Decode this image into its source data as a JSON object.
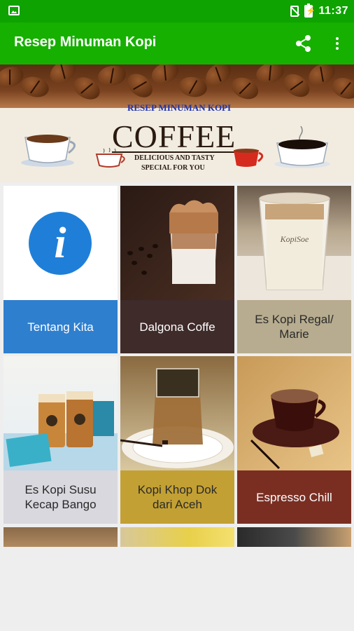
{
  "status_bar": {
    "time": "11:37",
    "icons": [
      "image-notification-icon",
      "no-sim-icon",
      "battery-charging-icon"
    ]
  },
  "app_bar": {
    "title": "Resep Minuman Kopi",
    "actions": [
      "share-icon",
      "more-vert-icon"
    ],
    "color": "#16b000"
  },
  "banner": {
    "label": "RESEP MINUMAN KOPI",
    "title": "COFFEE",
    "subtitle_line1": "DELICIOUS AND TASTY",
    "subtitle_line2": "SPECIAL FOR YOU"
  },
  "menu": {
    "items": [
      {
        "label": "Tentang Kita",
        "icon": "info-icon",
        "label_bg": "#2f7fcf"
      },
      {
        "label": "Dalgona Coffe",
        "icon": "dalgona-coffee-photo",
        "label_bg": "#3e2b2a"
      },
      {
        "label": "Es Kopi Regal/ Marie",
        "icon": "iced-coffee-cup-photo",
        "label_bg": "#b7ac8f"
      },
      {
        "label": "Es Kopi Susu Kecap Bango",
        "icon": "iced-coffee-bottles-photo",
        "label_bg": "#d8d8de"
      },
      {
        "label": "Kopi Khop Dok dari Aceh",
        "icon": "khop-coffee-glass-photo",
        "label_bg": "#c3a033"
      },
      {
        "label": "Espresso Chill",
        "icon": "espresso-cup-photo",
        "label_bg": "#7a2e22"
      }
    ]
  }
}
